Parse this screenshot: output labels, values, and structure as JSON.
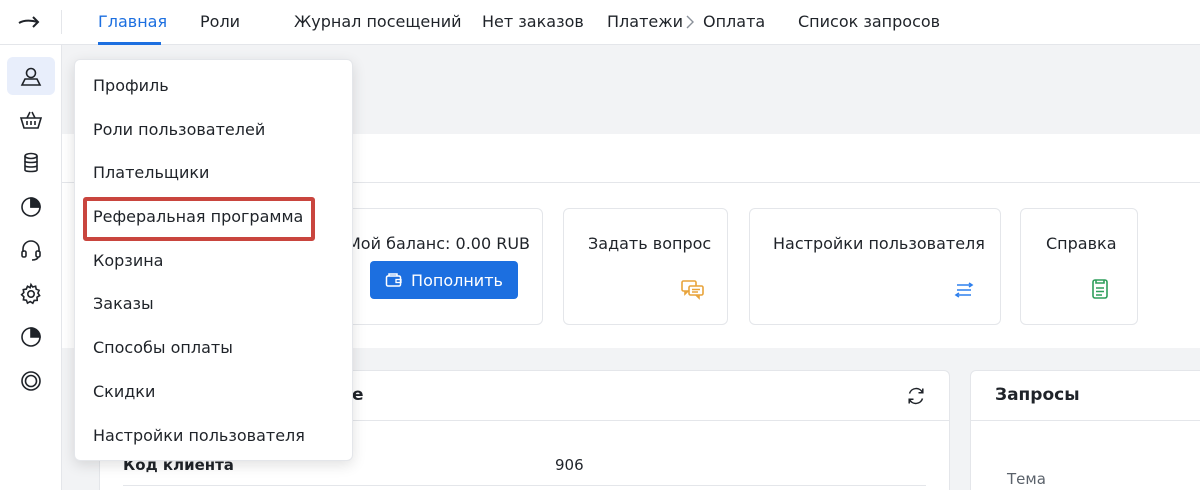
{
  "topbar": {
    "tabs": [
      {
        "label": "Главная",
        "active": true
      },
      {
        "label": "Роли",
        "active": false
      },
      {
        "label": "Журнал посещений",
        "active": false
      },
      {
        "label": "Нет заказов",
        "active": false
      }
    ],
    "breadcrumb": {
      "parent": "Платежи",
      "current": "Оплата"
    },
    "extra_link": "Список запросов"
  },
  "sidebar": {
    "icons": [
      "user-icon",
      "basket-icon",
      "database-icon",
      "pie-chart-icon",
      "headset-icon",
      "gear-icon",
      "pie-chart-icon",
      "lifebuoy-icon"
    ]
  },
  "dropdown": {
    "items": [
      "Профиль",
      "Роли пользователей",
      "Плательщики",
      "Реферальная программа",
      "Корзина",
      "Заказы",
      "Способы оплаты",
      "Скидки",
      "Настройки пользователя"
    ],
    "highlighted_index": 3
  },
  "cards": {
    "balance": {
      "label": "Мой баланс: 0.00 RUB",
      "button": "Пополнить"
    },
    "ask": {
      "label": "Задать вопрос"
    },
    "settings": {
      "label": "Настройки пользователя"
    },
    "help": {
      "label": "Справка"
    }
  },
  "client_panel": {
    "title_tail": "е",
    "row": {
      "key": "Код клиента",
      "value": "906"
    }
  },
  "requests_panel": {
    "title": "Запросы",
    "column": "Тема"
  },
  "colors": {
    "accent": "#1c6fe0",
    "highlight": "#c9453e",
    "orange_icon": "#e8a33a",
    "blue_icon": "#2f80ed",
    "green_icon": "#2e9e5b"
  }
}
